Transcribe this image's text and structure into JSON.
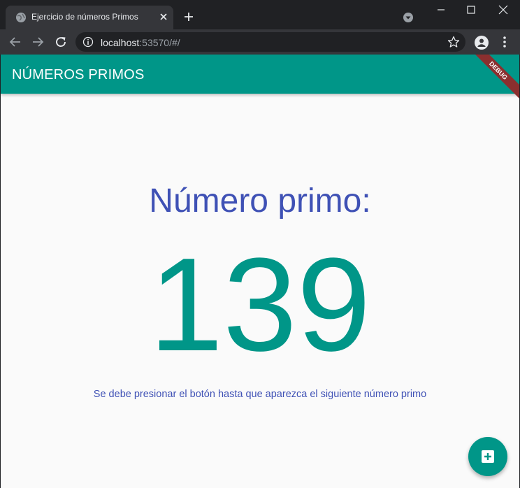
{
  "browser": {
    "tab_title": "Ejercicio de números Primos",
    "url_host": "localhost",
    "url_rest": ":53570/#/"
  },
  "icons": {
    "tab_favicon": "globe-icon",
    "tab_close": "close-icon",
    "new_tab": "plus-icon",
    "back": "arrow-left-icon",
    "forward": "arrow-right-icon",
    "reload": "reload-icon",
    "info": "info-icon",
    "star": "star-icon",
    "profile": "profile-icon",
    "menu": "kebab-menu-icon",
    "fab": "add-box-icon"
  },
  "app": {
    "title": "NÚMEROS PRIMOS",
    "debug_banner": "DEBUG",
    "label": "Número primo:",
    "number": "139",
    "hint": "Se debe presionar el botón hasta que aparezca el siguiente número primo"
  },
  "colors": {
    "primary": "#009688",
    "indigo": "#3f51b5",
    "background": "#fafafa",
    "browser_dark": "#202124",
    "browser_toolbar": "#35363a"
  }
}
